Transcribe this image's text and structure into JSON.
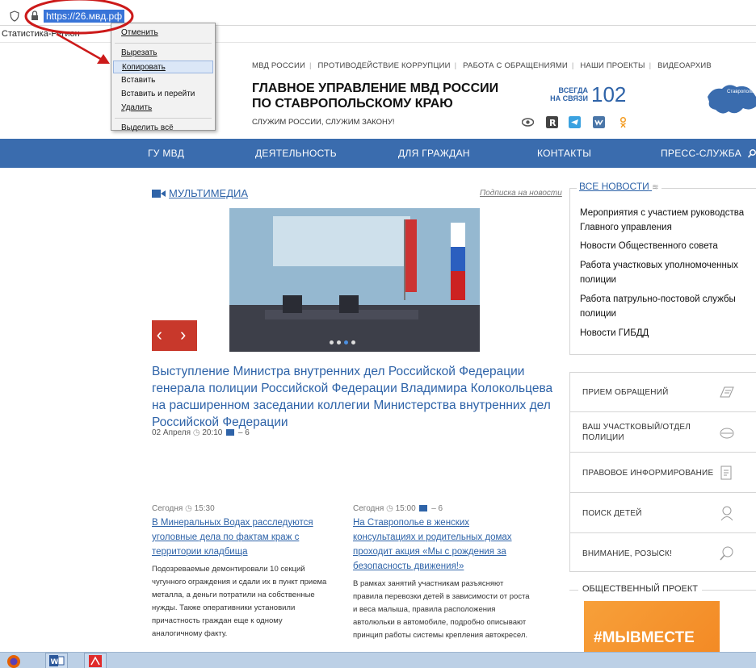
{
  "browser": {
    "url": "https://26.мвд.рф",
    "bookmark": "Статистика-Регион"
  },
  "context_menu": {
    "items": [
      "Отменить",
      "Вырезать",
      "Копировать",
      "Вставить",
      "Вставить и перейти",
      "Удалить",
      "Выделить всё"
    ],
    "highlighted": "Копировать"
  },
  "header": {
    "top_links": [
      "МВД РОССИИ",
      "ПРОТИВОДЕЙСТВИЕ КОРРУПЦИИ",
      "РАБОТА С ОБРАЩЕНИЯМИ",
      "НАШИ ПРОЕКТЫ",
      "ВИДЕОАРХИВ"
    ],
    "title_line1": "ГЛАВНОЕ УПРАВЛЕНИЕ МВД РОССИИ",
    "title_line2": "ПО СТАВРОПОЛЬСКОМУ КРАЮ",
    "slogan": "СЛУЖИМ РОССИИ, СЛУЖИМ ЗАКОНУ!",
    "hotline_caption_1": "ВСЕГДА",
    "hotline_caption_2": "НА СВЯЗИ",
    "hotline_number": "102",
    "region_label": "Ставрополь"
  },
  "nav": [
    "ГУ МВД",
    "ДЕЯТЕЛЬНОСТЬ",
    "ДЛЯ ГРАЖДАН",
    "КОНТАКТЫ",
    "ПРЕСС-СЛУЖБА"
  ],
  "multimedia": {
    "heading": "МУЛЬТИМЕДИА",
    "subscribe": "Подписка на новости",
    "arrows": "‹ ›",
    "main_title": "Выступление Министра внутренних дел Российской Федерации генерала полиции Российской Федерации Владимира Колокольцева на расширенном заседании коллегии Министерства внутренних дел Российской Федерации",
    "main_date": "02 Апреля",
    "main_time": "20:10",
    "main_photos": "– 6"
  },
  "news": [
    {
      "date": "Сегодня",
      "time": "15:30",
      "photos": "",
      "title": "В Минеральных Водах расследуются уголовные дела по фактам краж с территории кладбища",
      "text": "Подозреваемые демонтировали 10 секций чугунного ограждения и сдали их в пункт приема металла, а деньги потратили на собственные нужды. Также оперативники установили причастность граждан еще к одному аналогичному факту."
    },
    {
      "date": "Сегодня",
      "time": "15:00",
      "photos": "– 6",
      "title": "На Ставрополье в женских консультациях и родительных домах проходит акция «Мы с рождения за безопасность движения!»",
      "text": "В рамках занятий участникам разъясняют правила перевозки детей в зависимости от роста и веса малыша, правила расположения автолюльки в автомобиле, подробно описывают принцип работы системы крепления автокресел."
    }
  ],
  "sidebar": {
    "news_title": "ВСЕ НОВОСТИ",
    "news_links": [
      "Мероприятия с участием руководства Главного управления",
      "Новости Общественного совета",
      "Работа участковых уполномоченных полиции",
      "Работа патрульно-постовой службы полиции",
      "Новости ГИБДД"
    ],
    "services": [
      "ПРИЕМ ОБРАЩЕНИЙ",
      "ВАШ УЧАСТКОВЫЙ/ОТДЕЛ ПОЛИЦИИ",
      "ПРАВОВОЕ ИНФОРМИРОВАНИЕ",
      "ПОИСК ДЕТЕЙ",
      "ВНИМАНИЕ, РОЗЫСК!"
    ],
    "project_title": "ОБЩЕСТВЕННЫЙ ПРОЕКТ",
    "project_banner": "#МЫВМЕСТЕ"
  },
  "colors": {
    "nav_bg": "#3a6cae",
    "link": "#2e63a8",
    "accent_red": "#c8382b",
    "annotation": "#cc1a1a"
  }
}
